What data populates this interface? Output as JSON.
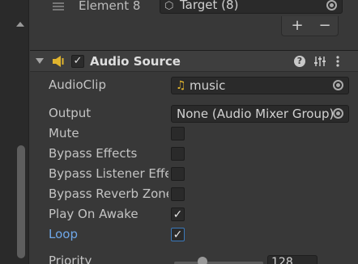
{
  "array_element": {
    "label": "Element 8",
    "value": "Target (8)"
  },
  "array_buttons": {
    "add": "+",
    "remove": "−"
  },
  "component": {
    "title": "Audio Source",
    "enabled": true,
    "icon_color": "#e0b42e"
  },
  "properties": {
    "audio_clip": {
      "label": "AudioClip",
      "value": "music"
    },
    "output": {
      "label": "Output",
      "value": "None (Audio Mixer Group)"
    },
    "mute": {
      "label": "Mute",
      "checked": false
    },
    "bypass_effects": {
      "label": "Bypass Effects",
      "checked": false
    },
    "bypass_listener_effects": {
      "label": "Bypass Listener Effe",
      "checked": false
    },
    "bypass_reverb_zones": {
      "label": "Bypass Reverb Zone",
      "checked": false
    },
    "play_on_awake": {
      "label": "Play On Awake",
      "checked": true
    },
    "loop": {
      "label": "Loop",
      "checked": true,
      "label_color": "#6fa7e8"
    },
    "priority": {
      "label": "Priority",
      "value": "128"
    }
  },
  "check_glyph": "✓"
}
